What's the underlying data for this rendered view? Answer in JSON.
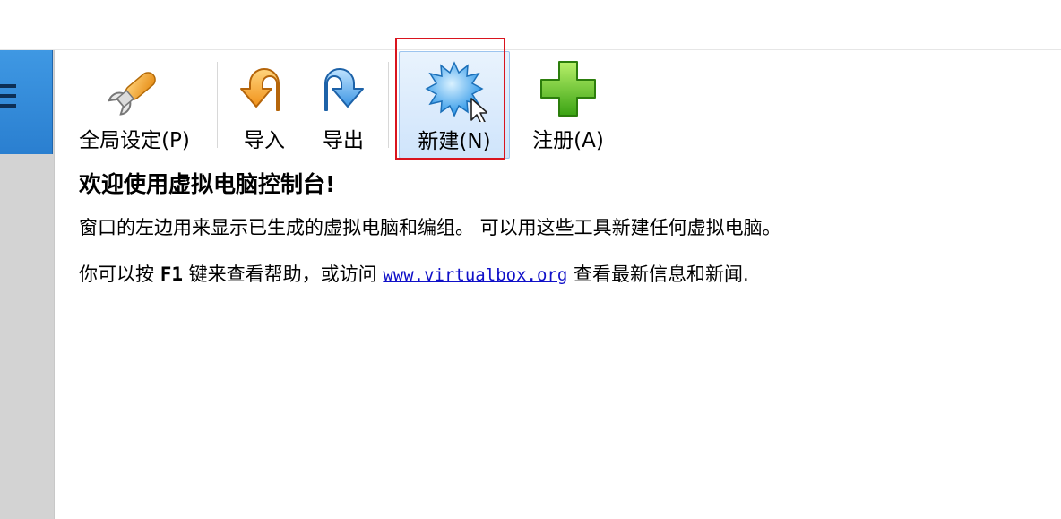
{
  "toolbar": {
    "global_settings_label": "全局设定(P)",
    "import_label": "导入",
    "export_label": "导出",
    "new_label": "新建(N)",
    "register_label": "注册(A)"
  },
  "welcome": {
    "title": "欢迎使用虚拟电脑控制台!",
    "line1": "窗口的左边用来显示已生成的虚拟电脑和编组。 可以用这些工具新建任何虚拟电脑。",
    "line2_prefix": "你可以按",
    "line2_key": "F1",
    "line2_middle": "键来查看帮助，或访问",
    "line2_link": "www.virtualbox.org",
    "line2_suffix": "查看最新信息和新闻."
  },
  "colors": {
    "accent_blue": "#2a7fd0",
    "link": "#1010c8",
    "highlight_red": "#d9141e",
    "sidebar_gray": "#d3d3d3"
  },
  "icons": {
    "global_settings": "wrench-icon",
    "import": "import-arrow-icon",
    "export": "export-arrow-icon",
    "new": "starburst-icon",
    "register": "plus-icon",
    "cursor": "mouse-pointer-icon"
  }
}
